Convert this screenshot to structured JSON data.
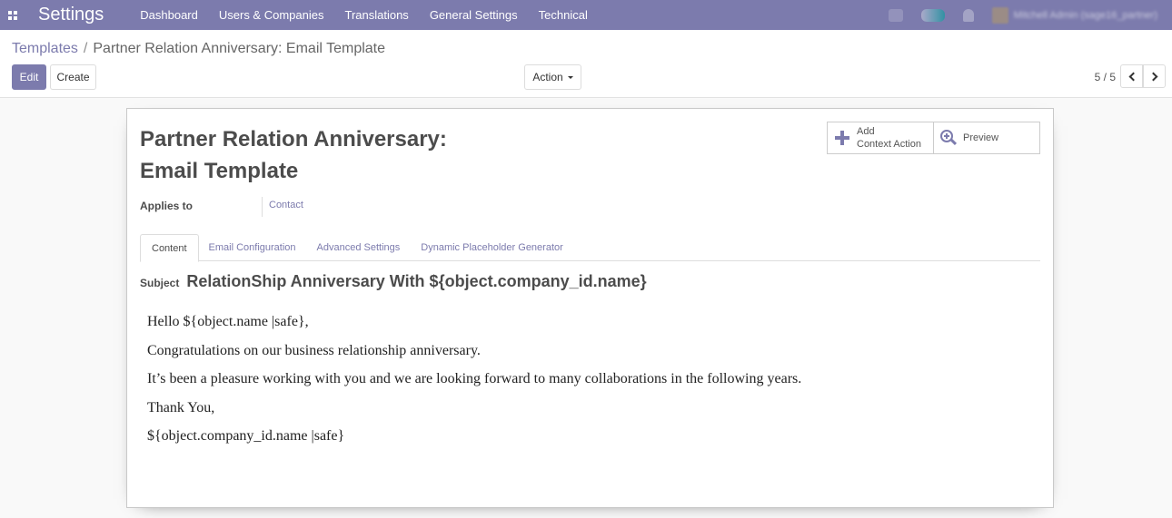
{
  "navbar": {
    "app_name": "Settings",
    "menu": [
      "Dashboard",
      "Users & Companies",
      "Translations",
      "General Settings",
      "Technical"
    ],
    "user_name": "Mitchell Admin (sage16_partner)"
  },
  "breadcrumb": {
    "parent": "Templates",
    "separator": "/",
    "current": "Partner Relation Anniversary: Email Template"
  },
  "buttons": {
    "edit": "Edit",
    "create": "Create",
    "action": "Action"
  },
  "pager": {
    "value": "5 / 5"
  },
  "form": {
    "title_line1": "Partner Relation Anniversary:",
    "title_line2": "Email Template",
    "smart_buttons": {
      "add_line1": "Add",
      "add_line2": "Context Action",
      "preview": "Preview"
    },
    "applies_to_label": "Applies to",
    "applies_to_value": "Contact",
    "tabs": [
      "Content",
      "Email Configuration",
      "Advanced Settings",
      "Dynamic Placeholder Generator"
    ],
    "active_tab": "Content",
    "subject_label": "Subject",
    "subject_value": "RelationShip Anniversary With ${object.company_id.name}",
    "body_lines": [
      "Hello ${object.name |safe},",
      "Congratulations on our business relationship anniversary.",
      "It’s been a pleasure working with you and we are looking forward to many collaborations in the following years.",
      "Thank You,",
      "${object.company_id.name |safe}"
    ]
  },
  "colors": {
    "brand": "#7c7bad",
    "text": "#4c4c4c",
    "background": "#f9f9f9"
  }
}
